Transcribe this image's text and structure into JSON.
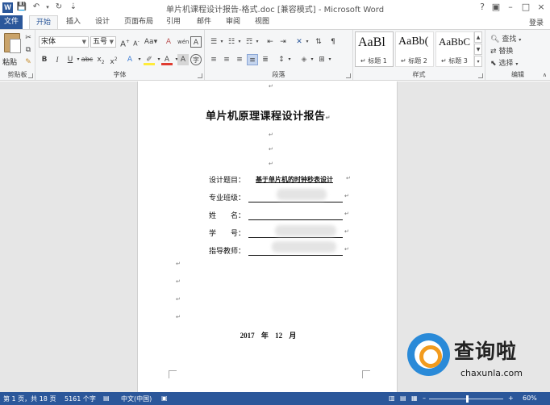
{
  "window": {
    "title": "单片机课程设计报告-格式.doc [兼容模式] - Microsoft Word",
    "help": "?",
    "minimize": "–",
    "maximize": "□",
    "close": "×"
  },
  "quick_access": {
    "save": "💾",
    "undo": "↶",
    "redo": "↻",
    "customize": "⇣"
  },
  "tabs": {
    "file": "文件",
    "items": [
      "开始",
      "插入",
      "设计",
      "页面布局",
      "引用",
      "邮件",
      "审阅",
      "视图"
    ],
    "active": "开始",
    "login": "登录"
  },
  "ribbon": {
    "clipboard": {
      "label": "剪贴板",
      "paste": "粘贴"
    },
    "font": {
      "label": "字体",
      "font_name": "宋体",
      "font_size": "五号"
    },
    "paragraph": {
      "label": "段落"
    },
    "styles": {
      "label": "样式",
      "items": [
        {
          "sample": "AaBl",
          "name": "↵ 标题 1"
        },
        {
          "sample": "AaBb(",
          "name": "↵ 标题 2"
        },
        {
          "sample": "AaBbC",
          "name": "↵ 标题 3"
        }
      ]
    },
    "editing": {
      "label": "编辑",
      "find": "查找",
      "replace": "替换",
      "select": "选择"
    }
  },
  "document": {
    "title": "单片机原理课程设计报告",
    "fields": [
      {
        "label": "设计题目：",
        "value": "基于单片机的时钟秒表设计"
      },
      {
        "label": "专业班级：",
        "value": ""
      },
      {
        "label": "姓　　名：",
        "value": ""
      },
      {
        "label": "学　　号：",
        "value": ""
      },
      {
        "label": "指导教师：",
        "value": ""
      }
    ],
    "date": "2017 年 12 月",
    "para_mark": "↵"
  },
  "watermark": {
    "text": "查询啦",
    "url": "chaxunla.com"
  },
  "status": {
    "page": "第 1 页，共 18 页",
    "words": "5161 个字",
    "language": "中文(中国)",
    "zoom_minus": "–",
    "zoom_plus": "+",
    "zoom": "60%",
    "zoom_level": 0.6
  },
  "colors": {
    "accent": "#2b579a",
    "ribbon_bg": "#f5f6f7",
    "workspace": "#e6e6e6"
  }
}
